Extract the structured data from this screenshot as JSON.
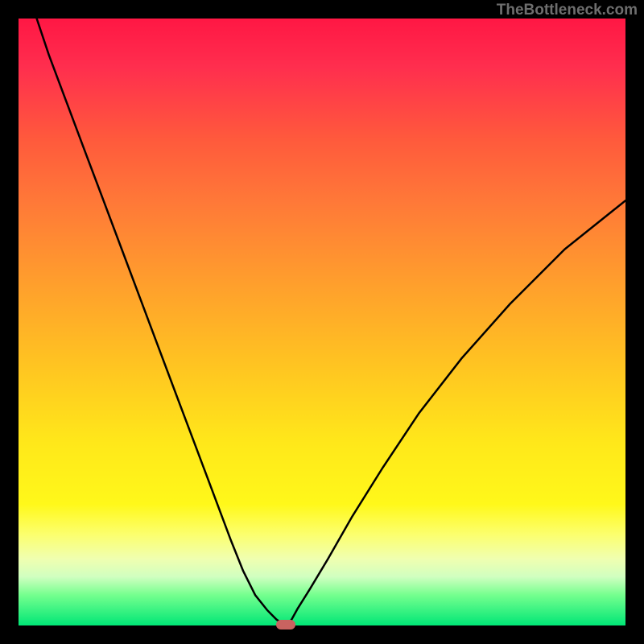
{
  "watermark": "TheBottleneck.com",
  "colors": {
    "frame": "#000000",
    "curve": "#000000",
    "marker": "#c96360"
  },
  "chart_data": {
    "type": "line",
    "title": "",
    "xlabel": "",
    "ylabel": "",
    "xlim": [
      0,
      100
    ],
    "ylim": [
      0,
      100
    ],
    "x": [
      3,
      5,
      8,
      11,
      14,
      17,
      20,
      23,
      26,
      29,
      32,
      35,
      37,
      39,
      41,
      42.5,
      43.5,
      44,
      44.5,
      45,
      46,
      48,
      51,
      55,
      60,
      66,
      73,
      81,
      90,
      100
    ],
    "values": [
      100,
      94,
      86,
      78,
      70,
      62,
      54,
      46,
      38,
      30,
      22,
      14,
      9,
      5,
      2.5,
      1.0,
      0.3,
      0.0,
      0.3,
      1.0,
      2.8,
      6,
      11,
      18,
      26,
      35,
      44,
      53,
      62,
      70
    ],
    "marker": {
      "x": 44,
      "y": 0
    },
    "background_gradient": {
      "top": "#ff1744",
      "mid": "#ffe81a",
      "bottom": "#00e676"
    }
  }
}
